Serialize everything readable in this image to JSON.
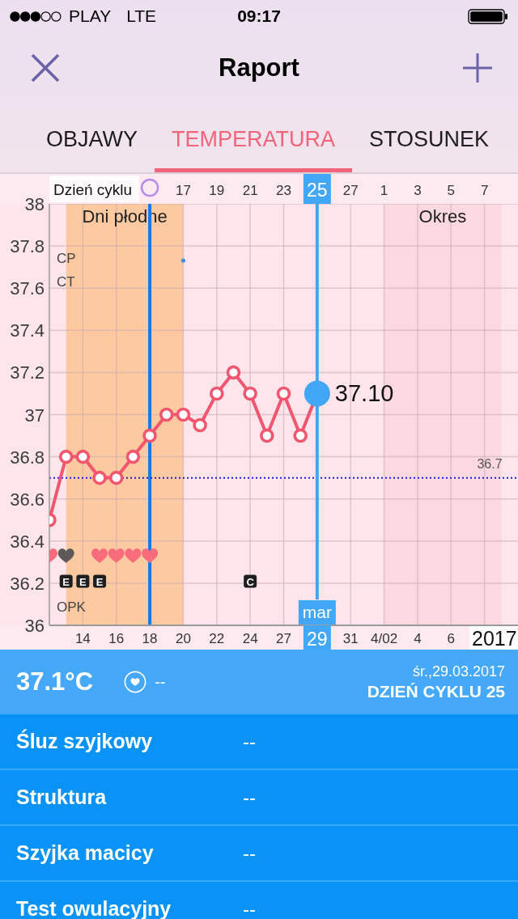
{
  "status_bar": {
    "carrier": "PLAY",
    "network": "LTE",
    "time": "09:17"
  },
  "nav": {
    "title": "Raport"
  },
  "tabs": [
    {
      "label": "OBJAWY",
      "selected": false
    },
    {
      "label": "TEMPERATURA",
      "selected": true
    },
    {
      "label": "STOSUNEK",
      "selected": false
    }
  ],
  "chart": {
    "chart_data": {
      "type": "line",
      "xlabel": "Dzień cyklu",
      "x": [
        9,
        10,
        11,
        12,
        13,
        14,
        15,
        16,
        17,
        18,
        19,
        20,
        21,
        22,
        23,
        24,
        25
      ],
      "series": [
        {
          "color": "#f2566e",
          "marker": "circle",
          "values": [
            36.5,
            36.8,
            36.8,
            36.7,
            36.7,
            36.8,
            36.9,
            37,
            37,
            36.95,
            37.1,
            37.2,
            37.1,
            36.9,
            37.1,
            36.9,
            37.1
          ]
        }
      ],
      "xlim": [
        9,
        37
      ],
      "ylim": [
        36,
        38
      ],
      "xticks": [
        17,
        19,
        21,
        23,
        25,
        27
      ],
      "yticks": [
        36,
        36.2,
        36.4,
        36.6,
        36.8,
        37,
        37.2,
        37.4,
        37.6,
        37.8,
        38
      ],
      "grid": true,
      "bands": [
        {
          "axis": "x",
          "from": 10,
          "to": 17,
          "label": "Dni płodne",
          "color": "#fdc9a0"
        },
        {
          "axis": "x",
          "from": 29,
          "to": 36,
          "label": "Okres",
          "color": "#fcd9e0"
        }
      ],
      "ref_lines": [
        {
          "axis": "x",
          "value": 15,
          "color": "#1479f0"
        },
        {
          "axis": "y",
          "value": 36.7,
          "label": "36.7",
          "color": "#1c1ce0"
        },
        {
          "axis": "x",
          "value": 25,
          "label": "mar",
          "color": "#42a7f6"
        }
      ],
      "annotations": [
        {
          "text": "37.10",
          "x": 25,
          "y": 37.1
        }
      ]
    },
    "next_cycle_ticks": [
      "1",
      "3",
      "5",
      "7"
    ],
    "date_ticks": [
      "14",
      "16",
      "18",
      "20",
      "22",
      "24",
      "27",
      "29",
      "31",
      "4/02",
      "4",
      "6"
    ],
    "year": "2017",
    "upper_rows": [
      {
        "label": "CP",
        "days": [
          {
            "kind": "blank"
          },
          {
            "kind": "blank"
          },
          {
            "kind": "blank"
          },
          {
            "kind": "blank"
          },
          {
            "kind": "blank"
          },
          {
            "kind": "blank"
          },
          {
            "kind": "blank"
          },
          {
            "kind": "blank"
          },
          {
            "kind": "dot"
          }
        ]
      },
      {
        "label": "CT"
      }
    ],
    "lower_rows": [
      {
        "days": [
          {
            "kind": "heart",
            "color": "#f86c7c"
          },
          {
            "kind": "heart",
            "color": "#5f5959"
          },
          {
            "kind": "blank"
          },
          {
            "kind": "heart",
            "color": "#f86c7c"
          },
          {
            "kind": "heart",
            "color": "#f86c7c"
          },
          {
            "kind": "heart",
            "color": "#f86c7c"
          },
          {
            "kind": "heart",
            "color": "#f86c7c"
          }
        ]
      },
      {
        "days": [
          {
            "kind": "blank"
          },
          {
            "kind": "tag",
            "label": "E"
          },
          {
            "kind": "tag",
            "label": "E"
          },
          {
            "kind": "tag",
            "label": "E"
          },
          {
            "kind": "blank"
          },
          {
            "kind": "blank"
          },
          {
            "kind": "blank"
          },
          {
            "kind": "blank"
          },
          {
            "kind": "blank"
          },
          {
            "kind": "blank"
          },
          {
            "kind": "blank"
          },
          {
            "kind": "blank"
          },
          {
            "kind": "tag",
            "label": "C"
          }
        ]
      },
      {
        "label": "OPK"
      }
    ]
  },
  "summary": {
    "temperature": "37.1°C",
    "heart_value": "--",
    "date": "śr.,29.03.2017",
    "cycle_day": "DZIEŃ CYKLU 25"
  },
  "entries": [
    {
      "label": "Śluz szyjkowy",
      "value": "--"
    },
    {
      "label": "Struktura",
      "value": "--"
    },
    {
      "label": "Szyjka macicy",
      "value": "--"
    },
    {
      "label": "Test owulacyjny",
      "value": "--"
    }
  ]
}
